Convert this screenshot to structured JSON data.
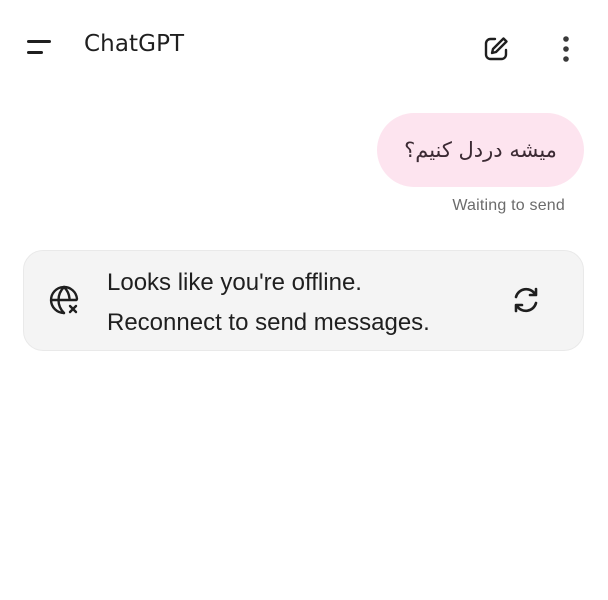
{
  "header": {
    "title": "ChatGPT",
    "menu_icon": "menu-icon",
    "edit_icon": "new-chat-edit-icon",
    "more_icon": "more-vertical-icon"
  },
  "conversation": {
    "user_message": "میشه دردل کنیم؟",
    "user_message_status": "Waiting to send"
  },
  "offline_notice": {
    "line1": "Looks like you're offline.",
    "line2": "Reconnect to send messages.",
    "icon": "globe-offline-icon",
    "retry_icon": "refresh-icon"
  },
  "colors": {
    "bubble_bg": "#fde4ef",
    "card_bg": "#f4f4f4",
    "text_primary": "#1f1f1f",
    "text_secondary": "#6b6b6b"
  }
}
